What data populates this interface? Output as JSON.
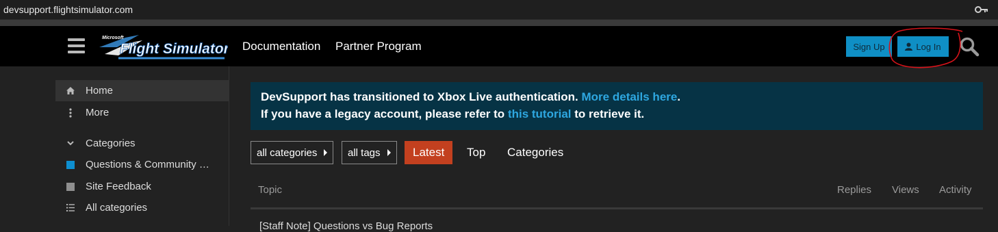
{
  "browser": {
    "url": "devsupport.flightsimulator.com",
    "key_icon": "key-icon"
  },
  "header": {
    "logo_text_small": "Microsoft",
    "logo_text": "Flight Simulator",
    "nav": [
      {
        "label": "Documentation"
      },
      {
        "label": "Partner Program"
      }
    ],
    "signup_label": "Sign Up",
    "login_label": "Log In",
    "accent_color": "#0f8fc5",
    "annotation_color": "#d8131a"
  },
  "sidebar": {
    "items": [
      {
        "label": "Home",
        "icon": "home-icon"
      },
      {
        "label": "More",
        "icon": "vertical-dots-icon"
      },
      {
        "label": "Categories",
        "icon": "chevron-down-icon"
      },
      {
        "label": "Questions & Community …",
        "icon": "category-square-icon",
        "color": "#0e8fd0"
      },
      {
        "label": "Site Feedback",
        "icon": "category-square-icon",
        "color": "#8f8f8f"
      },
      {
        "label": "All categories",
        "icon": "list-icon"
      }
    ]
  },
  "banner": {
    "line1_text": "DevSupport has transitioned to Xbox Live authentication.",
    "line1_link": "More details here",
    "line1_end": ".",
    "line2_text": "If you have a legacy account, please refer to",
    "line2_link": "this tutorial",
    "line2_end": "to retrieve it.",
    "background": "#063345"
  },
  "filters": {
    "categories": "all categories",
    "tags": "all tags"
  },
  "tabs": [
    {
      "label": "Latest",
      "active": true
    },
    {
      "label": "Top"
    },
    {
      "label": "Categories"
    }
  ],
  "table": {
    "headers": {
      "topic": "Topic",
      "replies": "Replies",
      "views": "Views",
      "activity": "Activity"
    },
    "first_row_peek": "[Staff Note] Questions vs Bug Reports"
  }
}
